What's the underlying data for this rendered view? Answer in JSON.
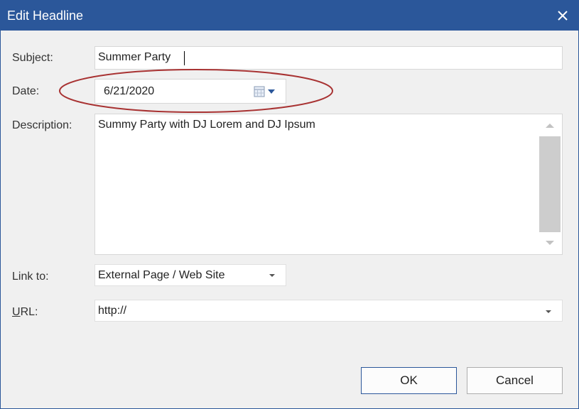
{
  "dialog": {
    "title": "Edit Headline",
    "close_icon": "close-icon"
  },
  "form": {
    "subject_label": "Subject:",
    "subject_value": "Summer Party",
    "date_label": "Date:",
    "date_value": "6/21/2020",
    "calendar_icon": "calendar-icon",
    "description_label": "Description:",
    "description_value": "Summy Party with DJ Lorem and DJ Ipsum",
    "link_label": "Link to:",
    "link_value": "External Page / Web Site",
    "url_label": "URL:",
    "url_value": "http://"
  },
  "buttons": {
    "ok": "OK",
    "cancel": "Cancel"
  },
  "colors": {
    "titlebar": "#2b579a",
    "annotation": "#a83232"
  }
}
